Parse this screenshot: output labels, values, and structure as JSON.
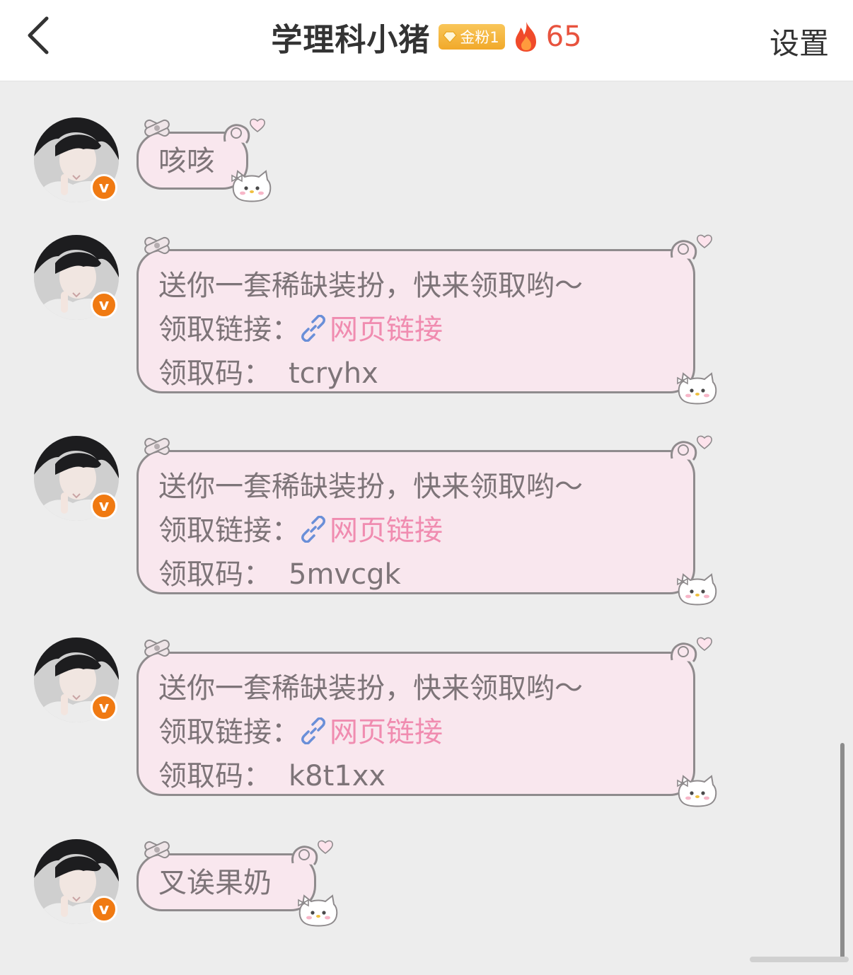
{
  "header": {
    "title": "学理科小猪",
    "fan_badge": "金粉1",
    "fire_count": "65",
    "settings_label": "设置"
  },
  "verified_mark": "v",
  "messages": [
    {
      "lines": [
        "咳咳"
      ]
    },
    {
      "line1": "送你一套稀缺装扮，快来领取哟～",
      "link_label": "领取链接：",
      "link_text": "网页链接",
      "code_label": "领取码：",
      "code": "tcryhx"
    },
    {
      "line1": "送你一套稀缺装扮，快来领取哟～",
      "link_label": "领取链接：",
      "link_text": "网页链接",
      "code_label": "领取码：",
      "code": "5mvcgk"
    },
    {
      "line1": "送你一套稀缺装扮，快来领取哟～",
      "link_label": "领取链接：",
      "link_text": "网页链接",
      "code_label": "领取码：",
      "code": "k8t1xx"
    },
    {
      "lines": [
        "叉诶果奶"
      ]
    }
  ],
  "colors": {
    "bubble_bg": "#f9e7ee",
    "bubble_border": "#8f8b8d",
    "link": "#f08cb0",
    "fire_count": "#e8533e",
    "verified": "#f07a12"
  }
}
